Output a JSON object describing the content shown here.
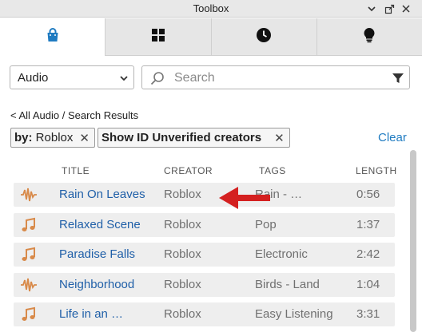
{
  "window": {
    "title": "Toolbox"
  },
  "tabs": [
    {
      "icon": "shopping-bag-icon",
      "active": true
    },
    {
      "icon": "grid-icon",
      "active": false
    },
    {
      "icon": "clock-icon",
      "active": false
    },
    {
      "icon": "lightbulb-icon",
      "active": false
    }
  ],
  "toolbar": {
    "category_value": "Audio",
    "search_placeholder": "Search"
  },
  "breadcrumb": {
    "back_label": "< All Audio",
    "separator": "/",
    "current": "Search Results"
  },
  "filters": [
    {
      "prefix": "by:",
      "value": "Roblox"
    },
    {
      "prefix": "",
      "value": "Show ID Unverified creators"
    }
  ],
  "clear_label": "Clear",
  "table": {
    "headers": {
      "title": "TITLE",
      "creator": "CREATOR",
      "tags": "TAGS",
      "length": "LENGTH"
    },
    "rows": [
      {
        "icon": "waveform-icon",
        "title": "Rain On Leaves",
        "creator": "Roblox",
        "tags": "Rain - …",
        "length": "0:56"
      },
      {
        "icon": "music-note-icon",
        "title": "Relaxed Scene",
        "creator": "Roblox",
        "tags": "Pop",
        "length": "1:37"
      },
      {
        "icon": "music-note-icon",
        "title": "Paradise Falls",
        "creator": "Roblox",
        "tags": "Electronic",
        "length": "2:42"
      },
      {
        "icon": "waveform-icon",
        "title": "Neighborhood",
        "creator": "Roblox",
        "tags": "Birds - Land",
        "length": "1:04"
      },
      {
        "icon": "music-note-icon",
        "title": "Life in an …",
        "creator": "Roblox",
        "tags": "Easy Listening",
        "length": "3:31"
      }
    ]
  },
  "colors": {
    "accent": "#1f7bc1",
    "link": "#1f5fa8",
    "audio_icon": "#d88a4a",
    "annotation_arrow": "#d42020"
  }
}
